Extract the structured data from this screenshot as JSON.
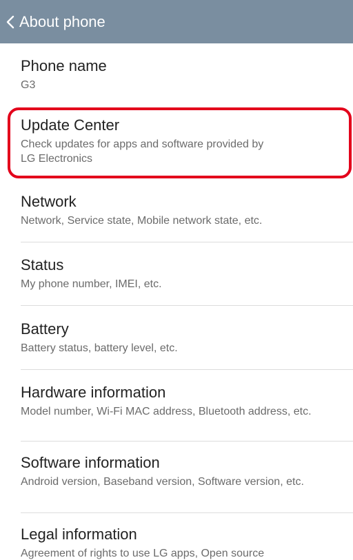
{
  "action_bar": {
    "back_icon": "chevron-left-icon",
    "title": "About phone",
    "background_color": "#7a8ea0"
  },
  "items": [
    {
      "title": "Phone name",
      "subtitle": "G3"
    },
    {
      "title": "Update Center",
      "subtitle": "Check updates for apps and software provided by LG Electronics"
    },
    {
      "title": "Network",
      "subtitle": "Network, Service state, Mobile network state, etc."
    },
    {
      "title": "Status",
      "subtitle": "My phone number, IMEI, etc."
    },
    {
      "title": "Battery",
      "subtitle": "Battery status, battery level, etc."
    },
    {
      "title": "Hardware information",
      "subtitle": "Model number, Wi-Fi MAC address, Bluetooth address, etc."
    },
    {
      "title": "Software information",
      "subtitle": "Android version, Baseband version, Software version, etc."
    },
    {
      "title": "Legal information",
      "subtitle": "Agreement of rights to use LG apps, Open source"
    }
  ],
  "highlight": {
    "target": "Update Center",
    "color": "#e3001b"
  }
}
